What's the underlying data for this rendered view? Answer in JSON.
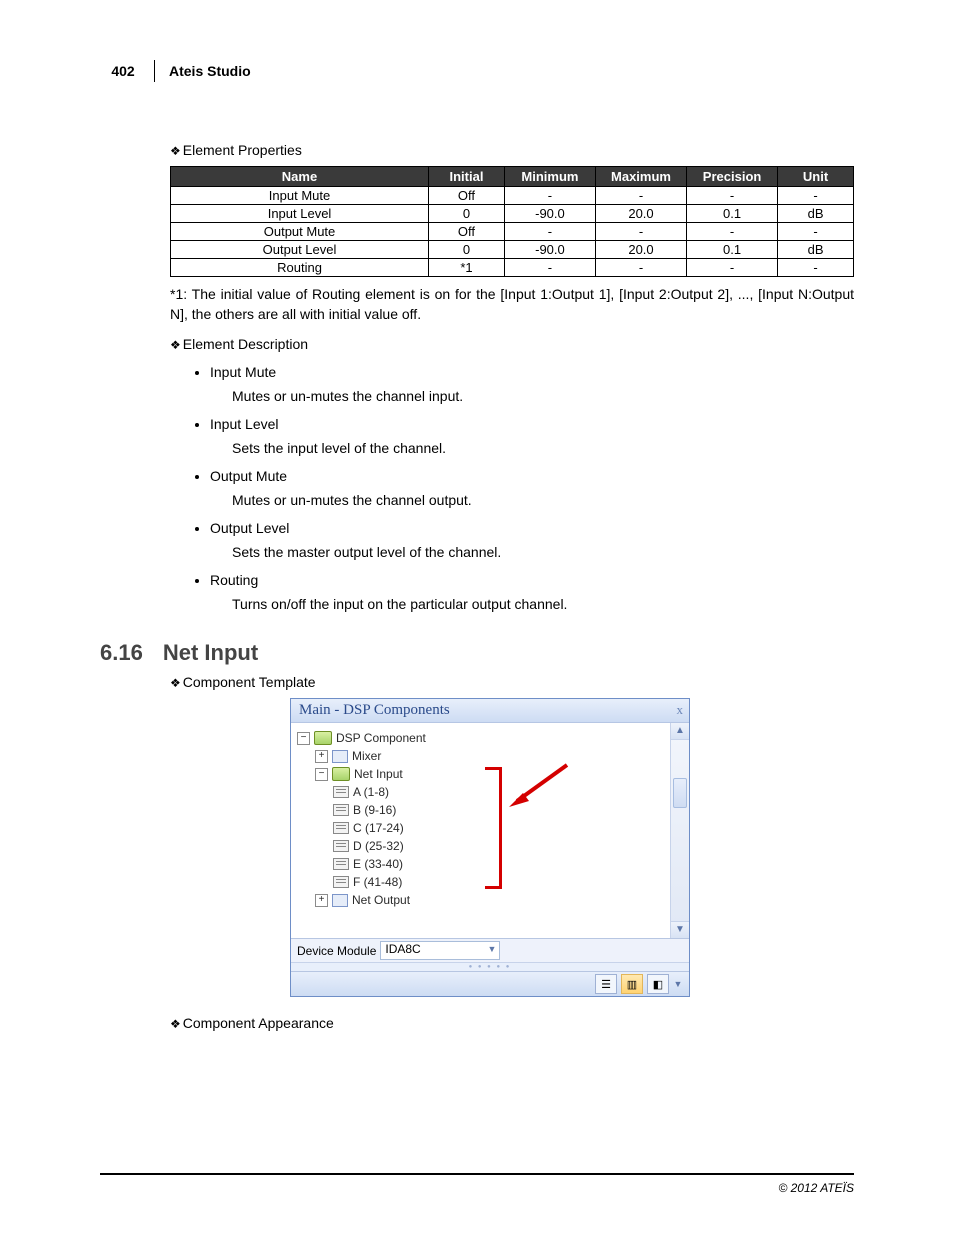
{
  "header": {
    "page_number": "402",
    "title": "Ateis Studio"
  },
  "props_heading": "Element Properties",
  "table": {
    "headers": [
      "Name",
      "Initial",
      "Minimum",
      "Maximum",
      "Precision",
      "Unit"
    ],
    "rows": [
      {
        "name": "Input Mute",
        "initial": "Off",
        "min": "-",
        "max": "-",
        "prec": "-",
        "unit": "-"
      },
      {
        "name": "Input Level",
        "initial": "0",
        "min": "-90.0",
        "max": "20.0",
        "prec": "0.1",
        "unit": "dB"
      },
      {
        "name": "Output Mute",
        "initial": "Off",
        "min": "-",
        "max": "-",
        "prec": "-",
        "unit": "-"
      },
      {
        "name": "Output Level",
        "initial": "0",
        "min": "-90.0",
        "max": "20.0",
        "prec": "0.1",
        "unit": "dB"
      },
      {
        "name": "Routing",
        "initial": "*1",
        "min": "-",
        "max": "-",
        "prec": "-",
        "unit": "-"
      }
    ]
  },
  "footnote": "*1: The initial value of Routing element is on for the [Input 1:Output 1], [Input 2:Output 2], ..., [Input N:Output N], the others are all with initial value off.",
  "desc_heading": "Element Description",
  "desc_items": [
    {
      "title": "Input Mute",
      "text": "Mutes or un-mutes the channel input."
    },
    {
      "title": "Input Level",
      "text": "Sets the input level of the channel."
    },
    {
      "title": "Output Mute",
      "text": "Mutes or un-mutes the channel output."
    },
    {
      "title": "Output Level",
      "text": "Sets the master output level of the channel."
    },
    {
      "title": "Routing",
      "text": "Turns on/off the input on the particular output channel."
    }
  ],
  "section": {
    "number": "6.16",
    "title": "Net Input"
  },
  "template_heading": "Component Template",
  "appearance_heading": "Component Appearance",
  "panel": {
    "title": "Main - DSP Components",
    "close": "x",
    "tree": {
      "root": "DSP Component",
      "mixer": "Mixer",
      "netinput": "Net Input",
      "children": [
        "A (1-8)",
        "B (9-16)",
        "C (17-24)",
        "D (25-32)",
        "E (33-40)",
        "F (41-48)"
      ],
      "netoutput": "Net Output"
    },
    "module_label": "Device Module",
    "module_value": "IDA8C"
  },
  "footer": "© 2012 ATEÏS"
}
